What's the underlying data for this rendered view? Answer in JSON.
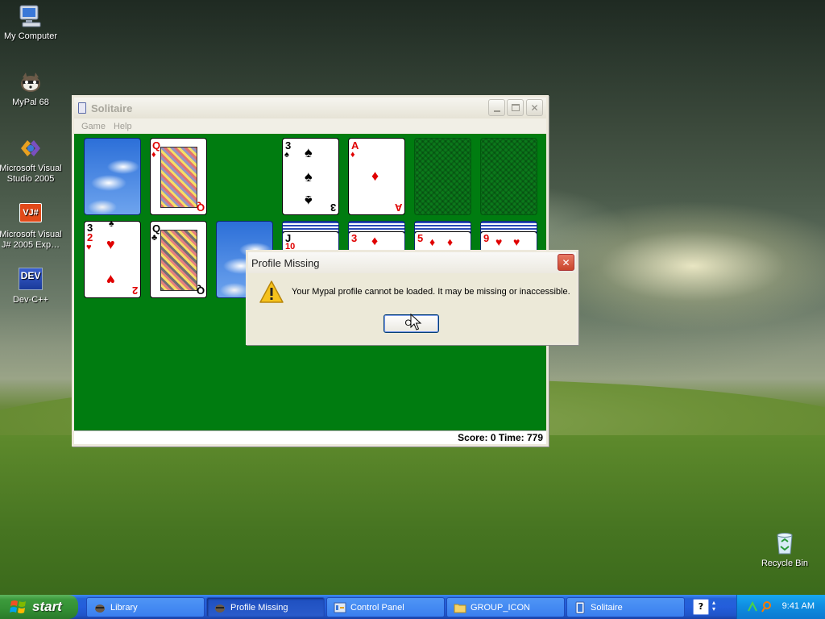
{
  "desktop": {
    "icons": [
      {
        "label": "My Computer",
        "icon": "my-computer-icon"
      },
      {
        "label": "MyPal 68",
        "icon": "mypal-icon"
      },
      {
        "label": "Microsoft Visual Studio 2005",
        "icon": "visual-studio-icon"
      },
      {
        "label": "Microsoft Visual J# 2005 Exp…",
        "icon": "visual-jsharp-icon"
      },
      {
        "label": "Dev-C++",
        "icon": "devcpp-icon"
      },
      {
        "label": "Recycle Bin",
        "icon": "recycle-bin-icon"
      }
    ],
    "devcpp_badge": "DEV",
    "vjs_badge": "VJ#"
  },
  "solitaire": {
    "title": "Solitaire",
    "menu": [
      "Game",
      "Help"
    ],
    "status": "Score: 0 Time: 779",
    "cards": {
      "top_row": [
        {
          "kind": "back-sky"
        },
        {
          "rank": "Q",
          "suit": "♦",
          "color": "red"
        },
        {
          "rank": "3",
          "suit": "♠",
          "color": "black"
        },
        {
          "rank": "A",
          "suit": "♦",
          "color": "red"
        },
        {
          "kind": "empty-foundation"
        },
        {
          "kind": "empty-foundation"
        }
      ],
      "tableau": [
        {
          "ranks": [
            "3",
            "2"
          ],
          "suit": "♥",
          "top_suit": "♠",
          "color": "red"
        },
        {
          "rank": "Q",
          "suit": "♣",
          "color": "black"
        },
        {
          "kind": "back-sky"
        },
        {
          "ranks": [
            "J",
            "10"
          ],
          "color": "black"
        },
        {
          "rank": "3",
          "suit": "♦",
          "color": "red"
        },
        {
          "rank": "5",
          "suit": "♦",
          "color": "red"
        },
        {
          "rank": "9",
          "suit": "♥",
          "color": "red"
        }
      ]
    }
  },
  "dialog": {
    "title": "Profile Missing",
    "message": "Your Mypal profile cannot be loaded. It may be missing or inaccessible.",
    "ok_label": "OK",
    "icon": "warning-icon"
  },
  "taskbar": {
    "start_label": "start",
    "items": [
      {
        "label": "Library",
        "icon": "mypal-icon",
        "active": false
      },
      {
        "label": "Profile Missing",
        "icon": "mypal-icon",
        "active": true
      },
      {
        "label": "Control Panel",
        "icon": "control-panel-icon",
        "active": false
      },
      {
        "label": "GROUP_ICON",
        "icon": "folder-icon",
        "active": false
      },
      {
        "label": "Solitaire",
        "icon": "solitaire-icon",
        "active": false
      }
    ],
    "lang_label": "?",
    "clock": "9:41 AM"
  },
  "colors": {
    "felt": "#007c10",
    "taskbar": "#245edb",
    "start": "#3c9a3c",
    "card_red": "#e00000"
  }
}
